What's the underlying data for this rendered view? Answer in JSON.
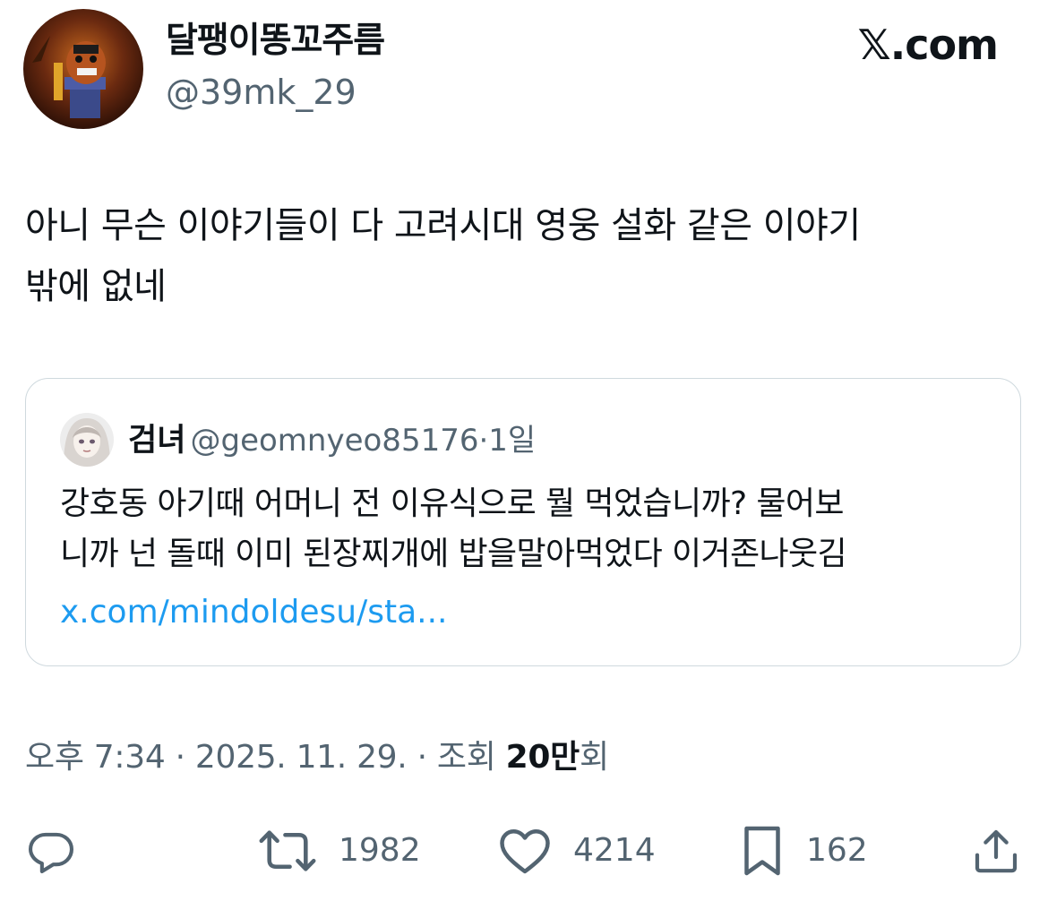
{
  "author": {
    "display_name": "달팽이똥꼬주름",
    "handle": "@39mk_29"
  },
  "brand": "𝕏.com",
  "tweet": {
    "text": "아니 무슨 이야기들이 다 고려시대 영웅 설화 같은 이야기\n밖에 없네"
  },
  "quoted_tweet": {
    "display_name": "검녀",
    "handle": "@geomnyeo85176",
    "separator": "·",
    "time": "1일",
    "text": "강호동 아기때 어머니 전 이유식으로 뭘 먹었습니까? 물어보\n니까 넌 돌때 이미 된장찌개에 밥을말아먹었다 이거존나웃김",
    "link": "x.com/mindoldesu/sta..."
  },
  "meta": {
    "time": "오후 7:34",
    "separator": " · ",
    "date": "2025. 11. 29.",
    "views_label": "조회 ",
    "views_count": "20만",
    "views_suffix": "회"
  },
  "actions": {
    "reply": {
      "icon": "reply-icon"
    },
    "retweet": {
      "icon": "retweet-icon",
      "count": "1982"
    },
    "like": {
      "icon": "heart-icon",
      "count": "4214"
    },
    "bookmark": {
      "icon": "bookmark-icon",
      "count": "162"
    },
    "share": {
      "icon": "share-icon"
    }
  },
  "colors": {
    "text": "#0f1419",
    "secondary": "#536471",
    "link": "#1d9bf0",
    "border": "#cfd9de"
  }
}
